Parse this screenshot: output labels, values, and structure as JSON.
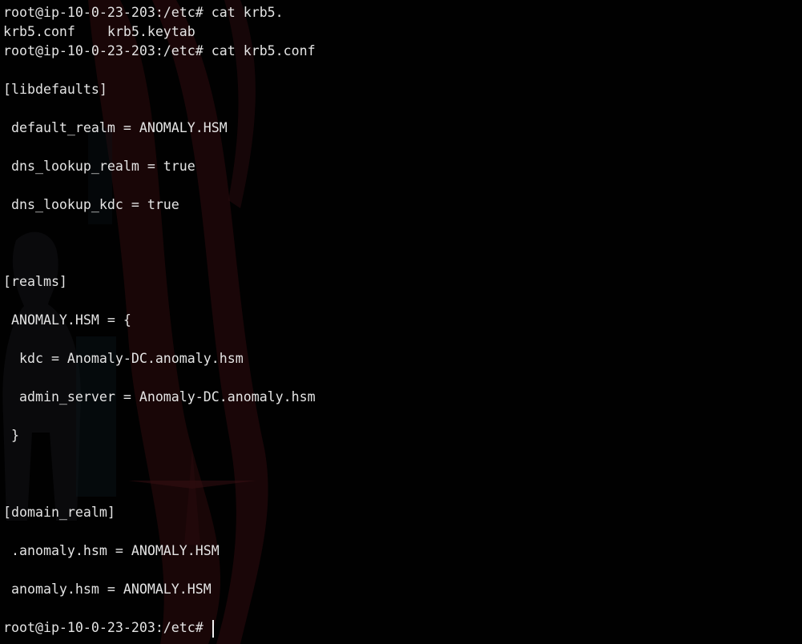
{
  "terminal": {
    "lines": [
      "root@ip-10-0-23-203:/etc# cat krb5.",
      "krb5.conf    krb5.keytab",
      "root@ip-10-0-23-203:/etc# cat krb5.conf",
      "",
      "[libdefaults]",
      "",
      " default_realm = ANOMALY.HSM",
      "",
      " dns_lookup_realm = true",
      "",
      " dns_lookup_kdc = true",
      "",
      "",
      "",
      "[realms]",
      "",
      " ANOMALY.HSM = {",
      "",
      "  kdc = Anomaly-DC.anomaly.hsm",
      "",
      "  admin_server = Anomaly-DC.anomaly.hsm",
      "",
      " }",
      "",
      "",
      "",
      "[domain_realm]",
      "",
      " .anomaly.hsm = ANOMALY.HSM",
      "",
      " anomaly.hsm = ANOMALY.HSM",
      "",
      "root@ip-10-0-23-203:/etc# "
    ]
  },
  "colors": {
    "background": "#010101",
    "foreground": "#e4e4e4",
    "cursor": "#f0f0f0"
  }
}
